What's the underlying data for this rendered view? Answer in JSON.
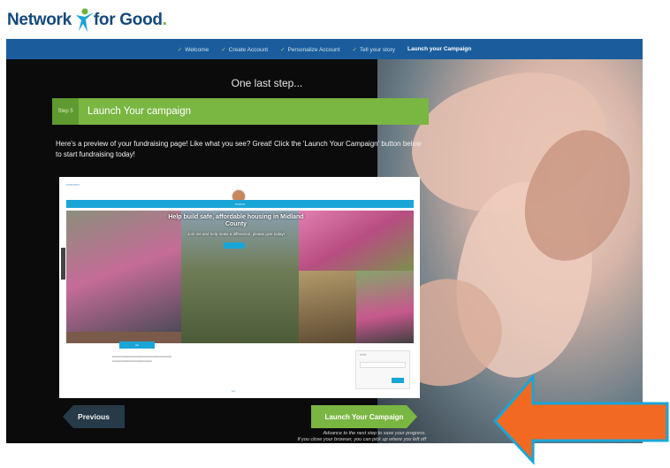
{
  "logo": {
    "part1": "Network",
    "part2": "for Good",
    "dot": "."
  },
  "steps": [
    {
      "label": "Welcome",
      "done": true
    },
    {
      "label": "Create Account",
      "done": true
    },
    {
      "label": "Personalize Account",
      "done": true
    },
    {
      "label": "Tell your story",
      "done": true
    },
    {
      "label": "Launch your Campaign",
      "done": false,
      "current": true
    }
  ],
  "main": {
    "heading": "One last step...",
    "step_badge": "Step 5",
    "section_title": "Launch Your campaign",
    "intro": "Here's a preview of your fundraising page! Like what you see? Great! Click the 'Launch Your Campaign' button below to start fundraising today!"
  },
  "preview": {
    "headline": "Help build safe, affordable housing in Midland County",
    "subtext": "Join me and help make a difference, please give today!"
  },
  "buttons": {
    "previous": "Previous",
    "launch": "Launch Your Campaign"
  },
  "note": {
    "line1": "Advance to the next step to save your progress.",
    "line2": "If you close your browser, you can pick up where you left off"
  },
  "colors": {
    "nav_blue": "#1b5d9c",
    "accent_green": "#7ab642",
    "arrow_orange": "#f26a21",
    "arrow_outline": "#1aa5d7"
  }
}
